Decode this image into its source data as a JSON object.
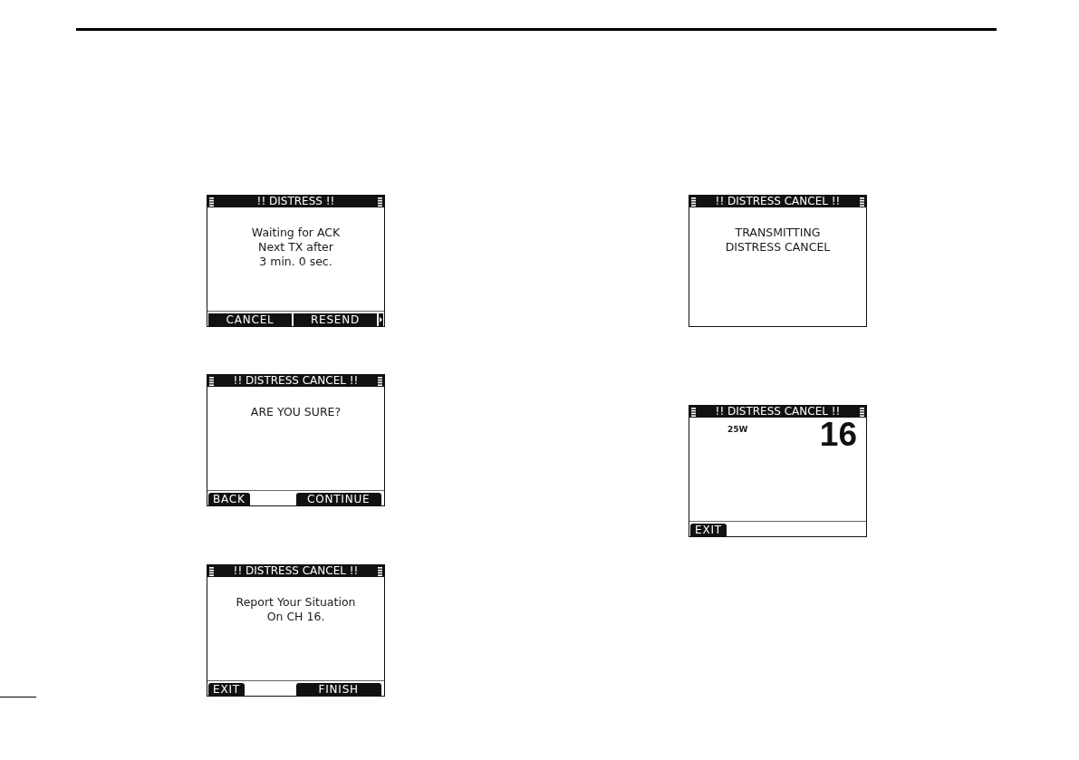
{
  "columns": [
    {
      "screens": [
        {
          "kind": "message",
          "title": "!! DISTRESS !!",
          "lines": [
            "Waiting for ACK",
            "Next TX after",
            "3 min. 0 sec."
          ],
          "softkeys": [
            {
              "label": "CANCEL",
              "kind": "segment"
            },
            {
              "label": "RESEND",
              "kind": "segment"
            }
          ],
          "more_arrow": true
        },
        {
          "kind": "message",
          "title": "!! DISTRESS CANCEL !!",
          "lines": [
            "ARE YOU SURE?"
          ],
          "softkeys": [
            {
              "label": "BACK",
              "kind": "tab"
            },
            {
              "label": "CONTINUE",
              "kind": "tab"
            }
          ],
          "more_arrow": false
        },
        {
          "kind": "message",
          "title": "!! DISTRESS CANCEL !!",
          "lines": [
            "Report Your Situation",
            "On CH 16."
          ],
          "softkeys": [
            {
              "label": "EXIT",
              "kind": "tab"
            },
            {
              "label": "FINISH",
              "kind": "tab"
            }
          ],
          "more_arrow": false
        }
      ]
    },
    {
      "screens": [
        {
          "kind": "message",
          "title": "!! DISTRESS CANCEL !!",
          "lines": [
            "TRANSMITTING",
            "DISTRESS CANCEL"
          ],
          "more_arrow": false
        },
        {
          "kind": "channel",
          "title": "!! DISTRESS CANCEL !!",
          "power": "25W",
          "channel": "16",
          "softkeys": [
            {
              "label": "EXIT",
              "kind": "tab"
            }
          ],
          "more_arrow": false
        }
      ]
    }
  ]
}
